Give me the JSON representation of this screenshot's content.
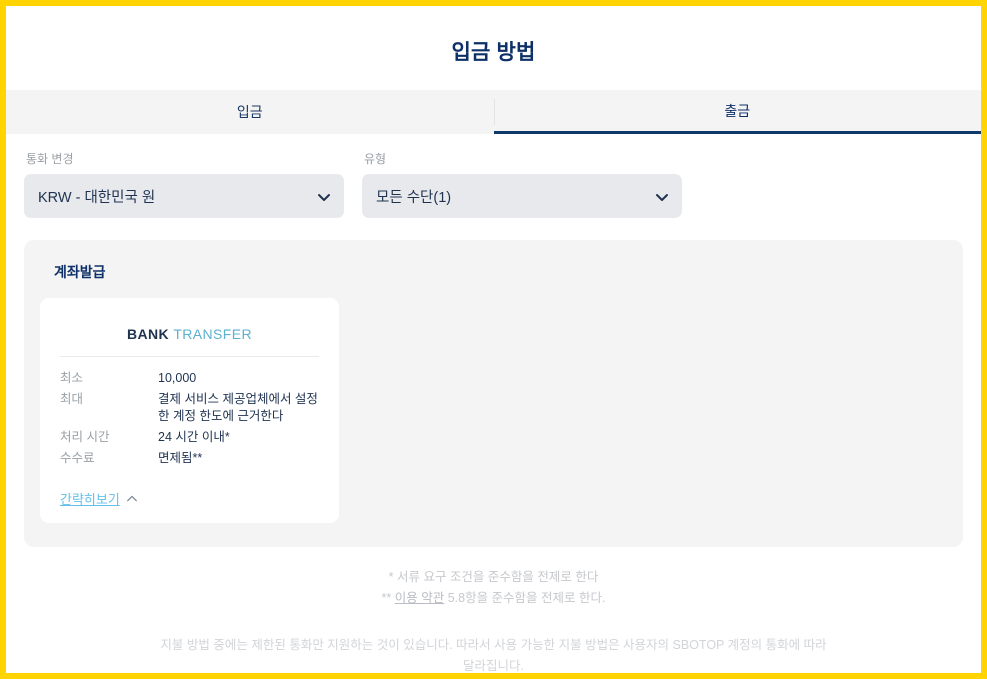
{
  "header": {
    "title": "입금 방법"
  },
  "tabs": [
    {
      "label": "입금",
      "active": false,
      "name": "tab-deposit"
    },
    {
      "label": "출금",
      "active": true,
      "name": "tab-withdrawal"
    }
  ],
  "filters": {
    "currency": {
      "label": "통화 변경",
      "value": "KRW - 대한민국 원"
    },
    "type": {
      "label": "유형",
      "value": "모든 수단(1)"
    }
  },
  "panel": {
    "title": "계좌발급",
    "cards": [
      {
        "brand_primary": "BANK",
        "brand_secondary": "TRANSFER",
        "rows": [
          {
            "label": "최소",
            "value": "10,000"
          },
          {
            "label": "최대",
            "value": "결제 서비스 제공업체에서 설정한 계정 한도에 근거한다"
          },
          {
            "label": "처리 시간",
            "value": "24 시간 이내*"
          },
          {
            "label": "수수료",
            "value": "면제됨**"
          }
        ],
        "toggle_label": "간략히보기"
      }
    ]
  },
  "footnotes": {
    "line1": "* 서류 요구 조건을 준수함을 전제로 한다",
    "line2_prefix": "** ",
    "line2_link": "이용 약관",
    "line2_suffix": " 5.8항을 준수함을 전제로 한다."
  },
  "bottom_note": "지불 방법 중에는 제한된 통화만 지원하는 것이 있습니다. 따라서 사용 가능한 지불 방법은 사용자의 SBOTOP 계정의 통화에 따라 달라집니다.",
  "colors": {
    "border": "#ffd400",
    "navy": "#0d3068",
    "tab_active_underline": "#0d3a6b",
    "brand_primary": "#1f3350",
    "brand_secondary": "#5cb0d2",
    "link_blue": "#63c0ea",
    "panel_bg": "#f4f4f5",
    "select_bg": "#e7e9ec",
    "muted": "#9aa0a6"
  }
}
